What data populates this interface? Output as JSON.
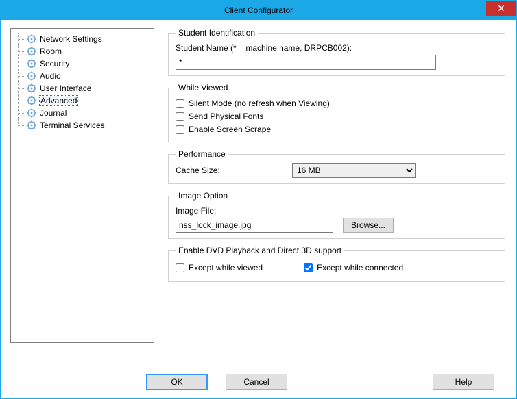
{
  "window": {
    "title": "Client Configurator"
  },
  "tree": {
    "items": [
      {
        "label": "Network Settings"
      },
      {
        "label": "Room"
      },
      {
        "label": "Security"
      },
      {
        "label": "Audio"
      },
      {
        "label": "User Interface"
      },
      {
        "label": "Advanced",
        "selected": true
      },
      {
        "label": "Journal"
      },
      {
        "label": "Terminal Services"
      }
    ]
  },
  "studentIdentification": {
    "legend": "Student Identification",
    "nameLabel": "Student Name (* = machine name, DRPCB002):",
    "nameValue": "*"
  },
  "whileViewed": {
    "legend": "While Viewed",
    "silentMode": {
      "label": "Silent Mode (no refresh when Viewing)",
      "checked": false
    },
    "sendFonts": {
      "label": "Send Physical Fonts",
      "checked": false
    },
    "screenScrape": {
      "label": "Enable Screen Scrape",
      "checked": false
    }
  },
  "performance": {
    "legend": "Performance",
    "cacheLabel": "Cache Size:",
    "cacheValue": "16 MB"
  },
  "imageOption": {
    "legend": "Image Option",
    "fileLabel": "Image File:",
    "fileValue": "nss_lock_image.jpg",
    "browseLabel": "Browse..."
  },
  "dvd": {
    "legend": "Enable DVD Playback and Direct 3D support",
    "exceptViewed": {
      "label": "Except while viewed",
      "checked": false
    },
    "exceptConnected": {
      "label": "Except while connected",
      "checked": true
    }
  },
  "buttons": {
    "ok": "OK",
    "cancel": "Cancel",
    "help": "Help"
  }
}
